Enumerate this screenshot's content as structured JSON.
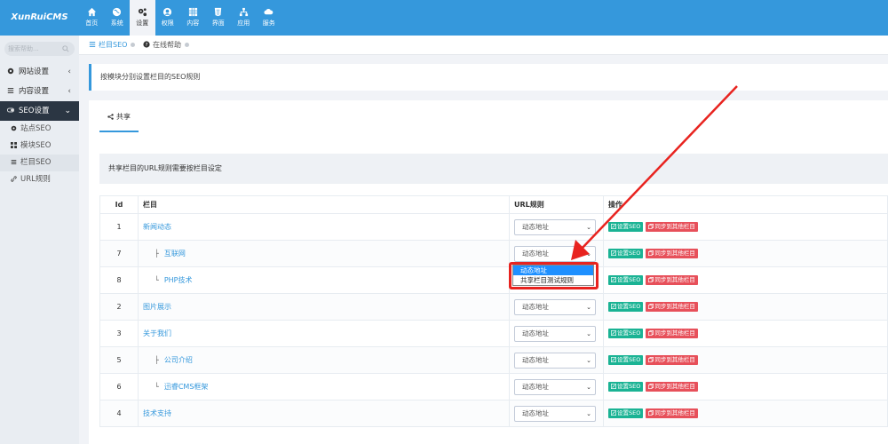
{
  "app": {
    "logo": "XunRuiCMS"
  },
  "nav": [
    {
      "label": "首页",
      "icon": "home-icon"
    },
    {
      "label": "系统",
      "icon": "globe-icon"
    },
    {
      "label": "设置",
      "icon": "gears-icon"
    },
    {
      "label": "权限",
      "icon": "user-circle-icon"
    },
    {
      "label": "内容",
      "icon": "grid-icon"
    },
    {
      "label": "界面",
      "icon": "html5-icon"
    },
    {
      "label": "应用",
      "icon": "sitemap-icon"
    },
    {
      "label": "服务",
      "icon": "cloud-icon"
    }
  ],
  "sidebar": {
    "search_placeholder": "搜索帮助...",
    "groups": [
      {
        "label": "网站设置",
        "icon": "gear-icon"
      },
      {
        "label": "内容设置",
        "icon": "list-icon"
      },
      {
        "label": "SEO设置",
        "icon": "toggle-icon"
      }
    ],
    "sub_items": [
      {
        "label": "站点SEO",
        "icon": "gear-icon"
      },
      {
        "label": "模块SEO",
        "icon": "grid-icon"
      },
      {
        "label": "栏目SEO",
        "icon": "list-icon"
      },
      {
        "label": "URL规则",
        "icon": "link-icon"
      }
    ]
  },
  "breadcrumb": {
    "current": "栏目SEO",
    "help": "在线帮助"
  },
  "note": "按模块分别设置栏目的SEO规则",
  "tabs": [
    {
      "label": "共享",
      "icon": "share-icon"
    }
  ],
  "info": "共享栏目的URL规则需要按栏目设定",
  "table": {
    "headers": {
      "id": "Id",
      "name": "栏目",
      "rule": "URL规则",
      "ops": "操作"
    },
    "rows": [
      {
        "id": "1",
        "name": "新闻动态",
        "level": 0,
        "prefix": "",
        "rule": "动态地址"
      },
      {
        "id": "7",
        "name": "互联网",
        "level": 1,
        "prefix": "├",
        "rule": "动态地址"
      },
      {
        "id": "8",
        "name": "PHP技术",
        "level": 1,
        "prefix": "└",
        "rule": ""
      },
      {
        "id": "2",
        "name": "图片展示",
        "level": 0,
        "prefix": "",
        "rule": "动态地址"
      },
      {
        "id": "3",
        "name": "关于我们",
        "level": 0,
        "prefix": "",
        "rule": "动态地址"
      },
      {
        "id": "5",
        "name": "公司介绍",
        "level": 1,
        "prefix": "├",
        "rule": "动态地址"
      },
      {
        "id": "6",
        "name": "迅睿CMS框架",
        "level": 1,
        "prefix": "└",
        "rule": "动态地址"
      },
      {
        "id": "4",
        "name": "技术支持",
        "level": 0,
        "prefix": "",
        "rule": "动态地址"
      }
    ],
    "btn_seo": "设置SEO",
    "btn_sync": "同步到其他栏目"
  },
  "dropdown": {
    "options": [
      "动态地址",
      "共享栏目测试规则"
    ],
    "highlighted": 0
  },
  "colors": {
    "primary": "#3598dc",
    "green": "#1ab394",
    "red": "#e7505a",
    "annotation": "#e8231f"
  }
}
